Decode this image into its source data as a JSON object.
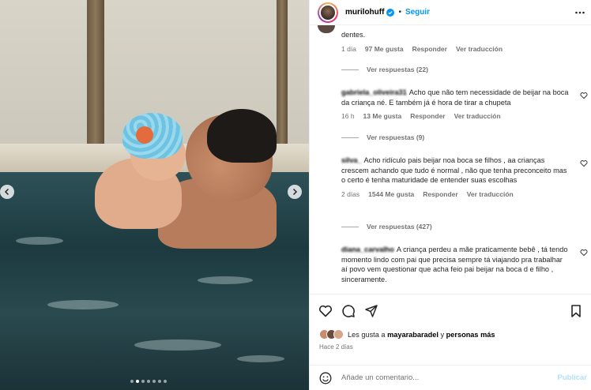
{
  "post": {
    "username": "murilohuff",
    "separator": "•",
    "follow_label": "Seguir"
  },
  "comments": [
    {
      "text": "dentes.",
      "time": "1 día",
      "likes": "97 Me gusta",
      "reply_label": "Responder",
      "translate_label": "Ver traducción",
      "replies_label": "Ver respuestas (22)"
    },
    {
      "user": "gabriela_oliveira31",
      "text": "Acho que não tem necessidade de beijar na boca da criança né. E também já é hora de tirar a chupeta",
      "time": "16 h",
      "likes": "13 Me gusta",
      "reply_label": "Responder",
      "translate_label": "Ver traducción",
      "replies_label": "Ver respuestas (9)"
    },
    {
      "user": "silva_",
      "text": "Acho ridículo pais beijar noa boca se filhos , aa crianças crescem achando que tudo é normal , não que tenha preconceito mas o certo é tenha maturidade de entender suas escolhas",
      "time": "2 días",
      "likes": "1544 Me gusta",
      "reply_label": "Responder",
      "translate_label": "Ver traducción",
      "replies_label": "Ver respuestas (427)"
    },
    {
      "user": "diana_carvalho",
      "text": "A criança perdeu a mãe praticamente bebê , tá tendo momento lindo com pai que precisa sempre tá viajando pra trabalhar aí povo vem questionar que acha feio pai beijar na boca d e filho , sinceramente.",
      "time": "",
      "likes": "",
      "reply_label": "",
      "translate_label": "",
      "replies_label": ""
    }
  ],
  "likes_summary": {
    "prefix": "Les gusta a",
    "user": "mayarabaradel",
    "conjunction": "y",
    "others": "personas más",
    "time": "Hace 2 días"
  },
  "add_comment": {
    "placeholder": "Añade un comentario...",
    "publish_label": "Publicar"
  },
  "icons": [
    "verified-icon",
    "more-options-icon",
    "heart-icon",
    "comment-icon",
    "share-icon",
    "bookmark-icon",
    "smile-icon",
    "chevron-left-icon",
    "chevron-right-icon"
  ],
  "colors": {
    "accent": "#0095f6",
    "publish_disabled": "#b2dffc",
    "muted": "#737373"
  }
}
